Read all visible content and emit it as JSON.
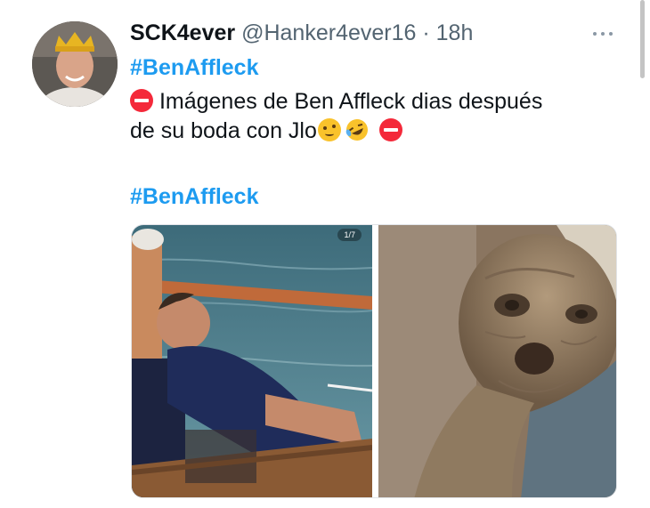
{
  "tweet": {
    "display_name": "SCK4ever",
    "handle": "@Hanker4ever16",
    "separator": "·",
    "time": "18h",
    "hashtag_top": "#BenAffleck",
    "text_line1": "Imágenes de Ben Affleck dias después",
    "text_line2": "de su boda con Jlo",
    "hashtag_bottom": "#BenAffleck",
    "emojis": [
      "no-entry-emoji",
      "woozy-face-emoji",
      "rolling-laughing-emoji",
      "no-entry-emoji"
    ]
  },
  "media": {
    "counter": "1/7",
    "images": [
      "man-sleeping-on-boat-photo",
      "aged-alien-creature-photo"
    ]
  },
  "colors": {
    "hashtag": "#1d9bf0",
    "secondary_text": "#536471",
    "no_entry": "#f4293a"
  }
}
